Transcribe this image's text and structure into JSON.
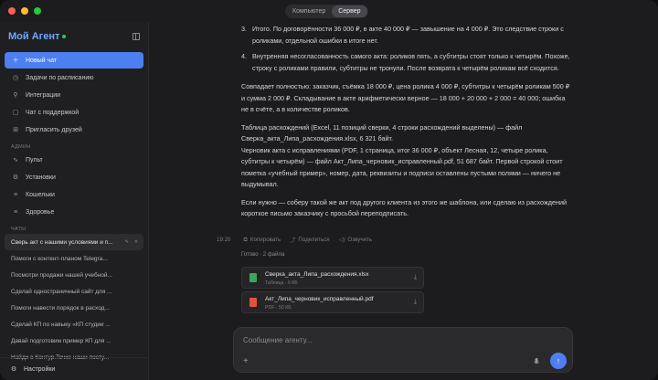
{
  "topbar": {
    "tabs": [
      "Компьютер",
      "Сервер"
    ],
    "active_tab": 1
  },
  "sidebar": {
    "brand": "Мой Агент",
    "nav": [
      {
        "label": "Новый чат",
        "icon": "plus-icon",
        "primary": true
      },
      {
        "label": "Задачи по расписанию",
        "icon": "clock-icon"
      },
      {
        "label": "Интеграции",
        "icon": "plug-icon"
      },
      {
        "label": "Чат с поддержкой",
        "icon": "chat-bubble-icon"
      },
      {
        "label": "Пригласить друзей",
        "icon": "gift-icon"
      }
    ],
    "admin_label": "АДМИН",
    "admin": [
      {
        "label": "Пульт",
        "icon": "pulse-icon"
      },
      {
        "label": "Установки",
        "icon": "gear-icon"
      },
      {
        "label": "Кошельки",
        "icon": "list-icon"
      },
      {
        "label": "Здоровье",
        "icon": "list-icon"
      }
    ],
    "chats_label": "ЧАТЫ",
    "chats": [
      "Сверь акт с нашими условиями и п...",
      "Помоги с контент-планом Telegra...",
      "Посмотри продажи нашей учебной...",
      "Сделай одностраничный сайт для ...",
      "Помоги навести порядок в расход...",
      "Сделай КП по навыку «КП студии ...",
      "Давай подготовим пример КП для ...",
      "Найди в Контур.Точке наши посту..."
    ],
    "settings": "Настройки"
  },
  "message": {
    "list": [
      {
        "num": "3.",
        "text": "Итого. По договорённости 36 000 ₽, в акте 40 000 ₽ — завышение на 4 000 ₽. Это следствие строки с роликами, отдельной ошибки в итоге нет."
      },
      {
        "num": "4.",
        "text": "Внутренняя несогласованность самого акта: роликов пять, а субтитры стоят только к четырём. Похоже, строку с роликами правили, субтитры не тронули. После возврата к четырём роликам всё сходится."
      }
    ],
    "para1": "Совпадает полностью: заказчик, съёмка 18 000 ₽, цена ролика 4 000 ₽, субтитры к четырём роликам 500 ₽ и сумма 2 000 ₽. Складывание в акте арифметически верное — 18 000 + 20 000 + 2 000 = 40 000; ошибка не в счёте, а в количестве роликов.",
    "para2_lines": [
      "Таблица расхождений (Excel, 11 позиций сверки, 4 строки расхождений выделены) — файл Сверка_акта_Липа_расхождения.xlsx, 6 321 байт.",
      "Черновик акта с исправлениями (PDF, 1 страница, итог 36 000 ₽, объект Лесная, 12, четыре ролика, субтитры к четырём) — файл Акт_Липа_черновик_исправленный.pdf, 51 687 байт. Первой строкой стоит пометка «учебный пример», номер, дата, реквизиты и подписи оставлены пустыми полями — ничего не выдумывал."
    ],
    "para3": "Если нужно — соберу такой же акт под другого клиента из этого же шаблона, или сделаю из расхождений короткое письмо заказчику с просьбой переподписать.",
    "time": "19:20",
    "actions": [
      "Копировать",
      "Поделиться",
      "Озвучить"
    ]
  },
  "files": {
    "header": "Готово · 2 файла",
    "items": [
      {
        "name": "Сверка_акта_Липа_расхождения.xlsx",
        "sub": "Таблица · 6 КБ",
        "icon": "spreadsheet-icon",
        "color": "#3aa55a"
      },
      {
        "name": "Акт_Липа_черновик_исправленный.pdf",
        "sub": "PDF · 50 КБ",
        "icon": "pdf-icon",
        "color": "#e0533a"
      }
    ]
  },
  "composer": {
    "placeholder": "Сообщение агенту..."
  }
}
